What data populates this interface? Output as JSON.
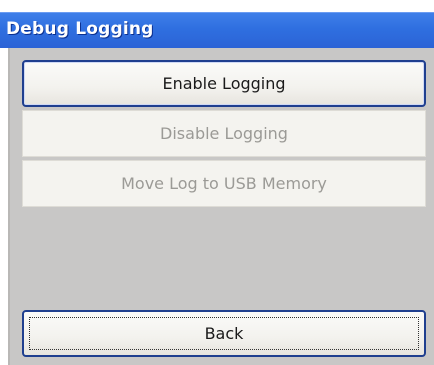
{
  "window": {
    "title": "Debug Logging"
  },
  "buttons": {
    "enable_logging": "Enable Logging",
    "disable_logging": "Disable Logging",
    "move_log": "Move Log to USB Memory",
    "back": "Back"
  },
  "states": {
    "enable_logging_enabled": true,
    "disable_logging_enabled": false,
    "move_log_enabled": false,
    "back_enabled": true
  },
  "colors": {
    "title_bar": "#2f6fe0",
    "client_background": "#c8c7c6",
    "button_border": "#1f3f8f",
    "disabled_text": "#9b9a96"
  }
}
